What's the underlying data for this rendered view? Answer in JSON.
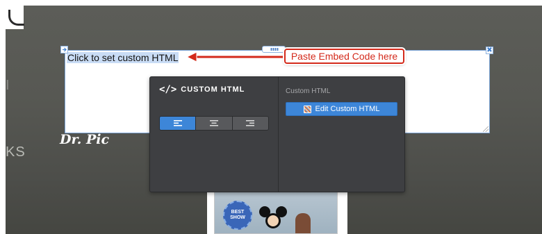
{
  "canvas": {
    "side_text_top": "I",
    "side_nav_text": "KS",
    "page_heading": "Dr. Pic"
  },
  "html_element": {
    "placeholder": "Click to set custom HTML",
    "corner_left_icon": "arrow-icon",
    "corner_right_icon": "close-icon",
    "corner_right_glyph": "✖"
  },
  "annotation": {
    "callout_text": "Paste Embed Code here",
    "color": "#d42a1b"
  },
  "photo": {
    "badge_text": "BEST SHOW"
  },
  "panel": {
    "title_icon": "</>",
    "title": "CUSTOM HTML",
    "alignment": {
      "options": [
        "left",
        "center",
        "right"
      ],
      "selected": "left"
    },
    "section_label": "Custom HTML",
    "edit_button_label": "Edit Custom HTML",
    "accent_color": "#3d86d8"
  }
}
